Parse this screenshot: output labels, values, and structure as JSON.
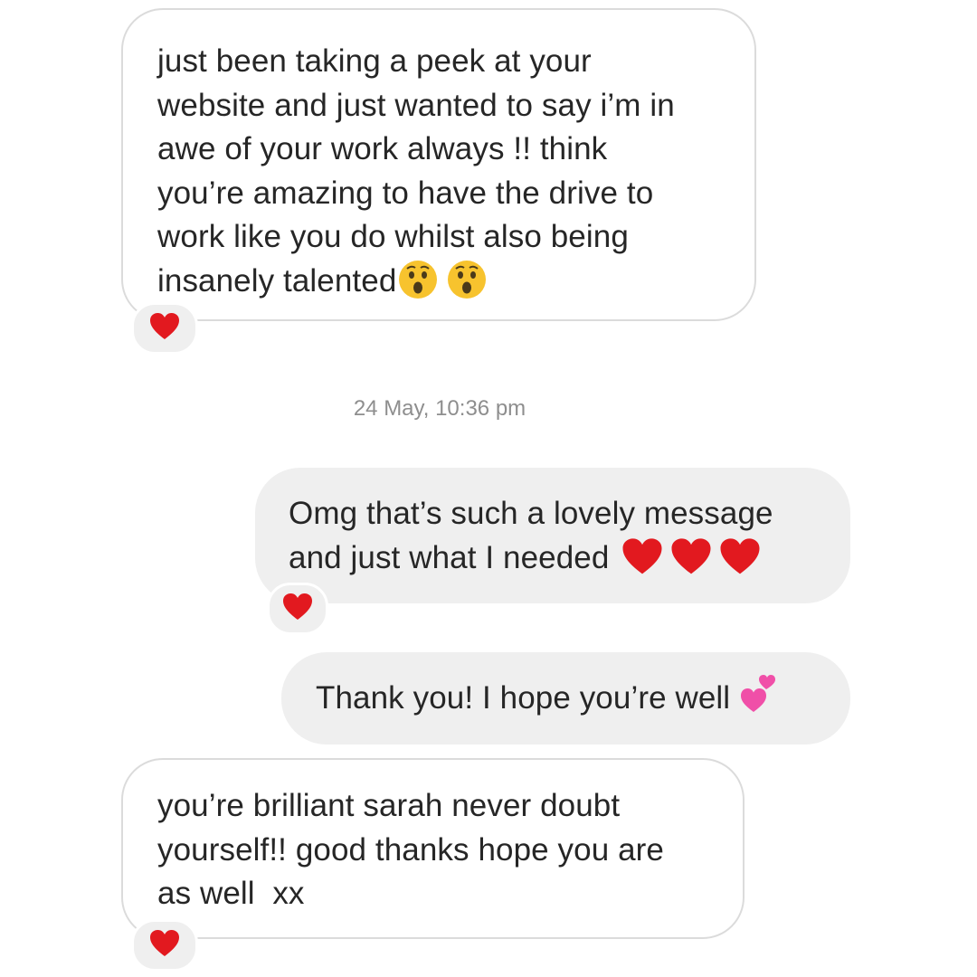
{
  "conversation": {
    "timestamp": "24 May, 10:36 pm",
    "messages": [
      {
        "direction": "incoming",
        "lines": [
          "just been taking a peek at your",
          "website and just wanted to say i’m in",
          "awe of your work always !! think",
          "you’re amazing to have the drive to",
          "work like you do whilst also being",
          "insanely talented"
        ],
        "trailing_emoji": [
          "astonished-face",
          "astonished-face"
        ],
        "reaction": "red-heart"
      },
      {
        "direction": "outgoing",
        "lines": [
          "Omg that’s such a lovely message",
          "and just what I needed"
        ],
        "trailing_emoji": [
          "red-heart",
          "red-heart",
          "red-heart"
        ],
        "reaction": "red-heart"
      },
      {
        "direction": "outgoing",
        "lines": [
          "Thank you! I hope you’re well"
        ],
        "trailing_emoji": [
          "two-hearts"
        ]
      },
      {
        "direction": "incoming",
        "lines": [
          "you’re brilliant sarah never doubt",
          "yourself!! good thanks hope you are",
          "as well  xx"
        ],
        "reaction": "red-heart"
      }
    ]
  },
  "colors": {
    "outgoing_bubble": "#efefef",
    "incoming_border": "#dbdbdb",
    "text": "#262626",
    "timestamp": "#8e8e8e",
    "heart": "#e2191f",
    "emoji_face": "#f7c32e",
    "pink_heart": "#f04fa8"
  }
}
